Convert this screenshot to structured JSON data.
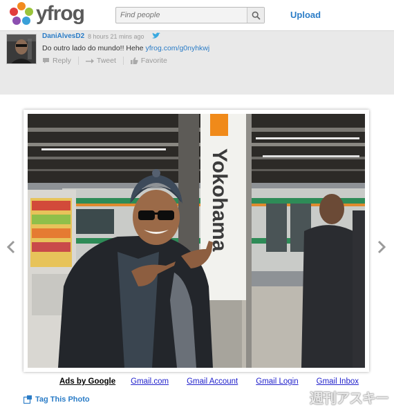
{
  "header": {
    "logo_text": "yfrog",
    "search_placeholder": "Find people",
    "upload_label": "Upload"
  },
  "tweet": {
    "username": "DaniAlvesD2",
    "timestamp": "8 hours 21 mins ago",
    "text": "Do outro lado do mundo!! Hehe",
    "link": "yfrog.com/g0nyhkwj",
    "actions": [
      "Reply",
      "Tweet",
      "Favorite"
    ]
  },
  "photo": {
    "sign_text": "Yokohama"
  },
  "ads": {
    "label": "Ads by Google",
    "links": [
      "Gmail.com",
      "Gmail Account",
      "Gmail Login",
      "Gmail Inbox"
    ]
  },
  "tag_photo_label": "Tag This Photo",
  "watermark": "週刊アスキー",
  "colors": {
    "accent": "#2a7cc7",
    "tweet_bg": "#e9e9e9",
    "ad_link": "#2222cc"
  }
}
